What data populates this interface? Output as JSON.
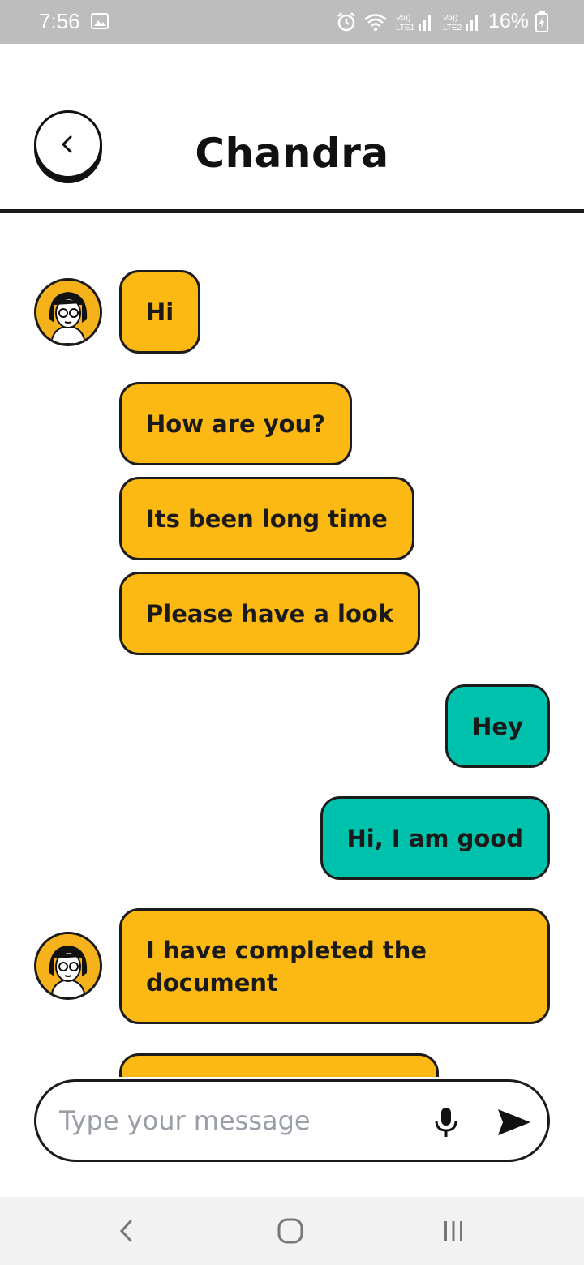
{
  "status_bar": {
    "time": "7:56",
    "battery": "16%",
    "icons": [
      "image-icon",
      "alarm-icon",
      "wifi-icon",
      "signal-lte1-icon",
      "signal-lte2-icon",
      "battery-charging-icon"
    ]
  },
  "header": {
    "title": "Chandra",
    "back_icon": "chevron-left-icon"
  },
  "messages": [
    {
      "text": "Hi",
      "direction": "in",
      "avatar": true
    },
    {
      "text": "How are you?",
      "direction": "in",
      "avatar": false
    },
    {
      "text": "Its been long time",
      "direction": "in",
      "avatar": false
    },
    {
      "text": "Please have a look",
      "direction": "in",
      "avatar": false
    },
    {
      "text": "Hey",
      "direction": "out",
      "avatar": false
    },
    {
      "text": "Hi, I am good",
      "direction": "out",
      "avatar": false
    },
    {
      "text": "I have completed the document",
      "direction": "in",
      "avatar": true
    },
    {
      "text": "",
      "direction": "in",
      "avatar": false
    }
  ],
  "composer": {
    "placeholder": "Type your message",
    "mic_icon": "microphone-icon",
    "send_icon": "send-icon"
  },
  "nav_bar": {
    "icons": [
      "nav-back-icon",
      "nav-home-icon",
      "nav-recents-icon"
    ]
  },
  "colors": {
    "incoming_bubble": "#fdb913",
    "outgoing_bubble": "#00c2ac",
    "border": "#1a1a1a",
    "status_bar": "#bdbdbd"
  }
}
